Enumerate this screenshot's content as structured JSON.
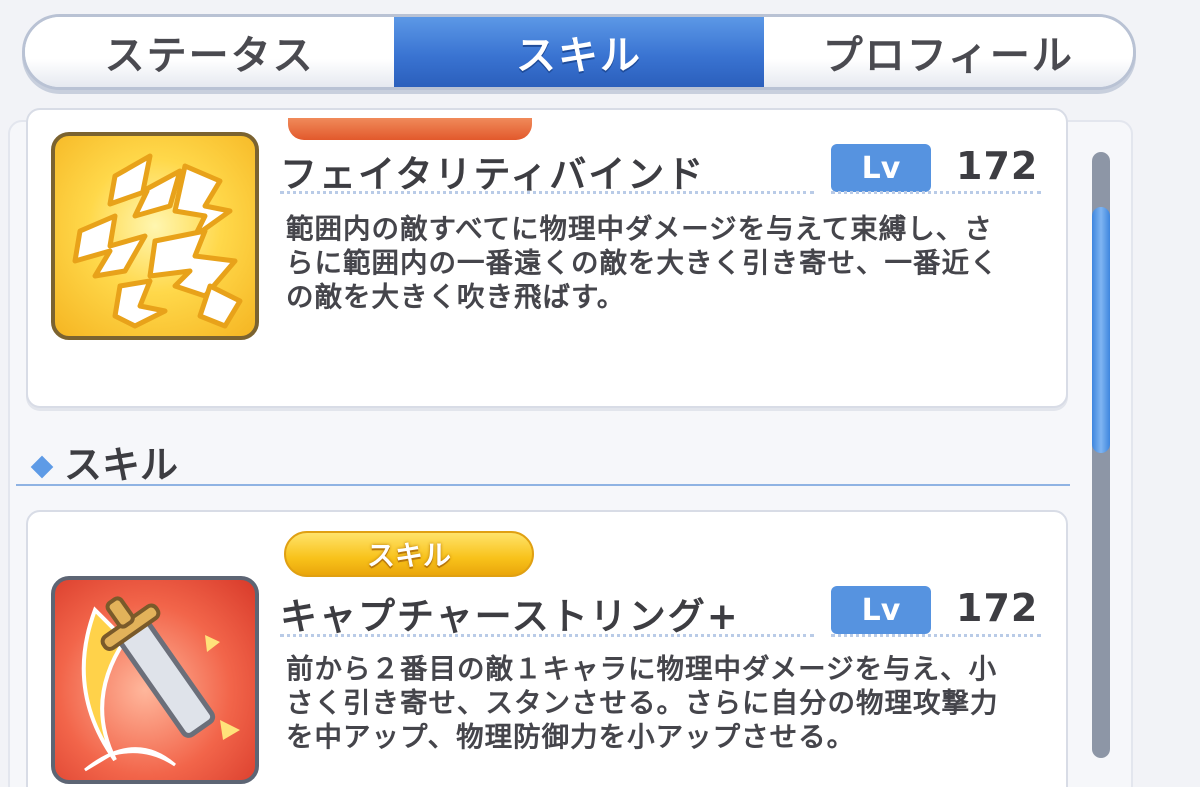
{
  "tabs": [
    {
      "label": "ステータス",
      "active": false
    },
    {
      "label": "スキル",
      "active": true
    },
    {
      "label": "プロフィール",
      "active": false
    }
  ],
  "union_burst": {
    "name": "フェイタリティバインド",
    "lv_label": "Lv",
    "level": "172",
    "description": "範囲内の敵すべてに物理中ダメージを与えて束縛し、さらに範囲内の一番遠くの敵を大きく引き寄せ、一番近くの敵を大きく吹き飛ばす。",
    "icon": "lightning-chain-icon"
  },
  "section": {
    "title": "スキル"
  },
  "skill1": {
    "tag": "スキル",
    "name": "キャプチャーストリング+",
    "lv_label": "Lv",
    "level": "172",
    "description": "前から２番目の敵１キャラに物理中ダメージを与え、小さく引き寄せ、スタンさせる。さらに自分の物理攻撃力を中アップ、物理防御力を小アップさせる。",
    "icon": "flaming-sword-icon"
  },
  "scrollbar": {
    "position": 0.15
  },
  "colors": {
    "accent_blue": "#3a74d2",
    "lv_blue": "#5693e0",
    "skill_tag_yellow": "#f8c21a",
    "ub_tag_orange": "#e2592c"
  }
}
